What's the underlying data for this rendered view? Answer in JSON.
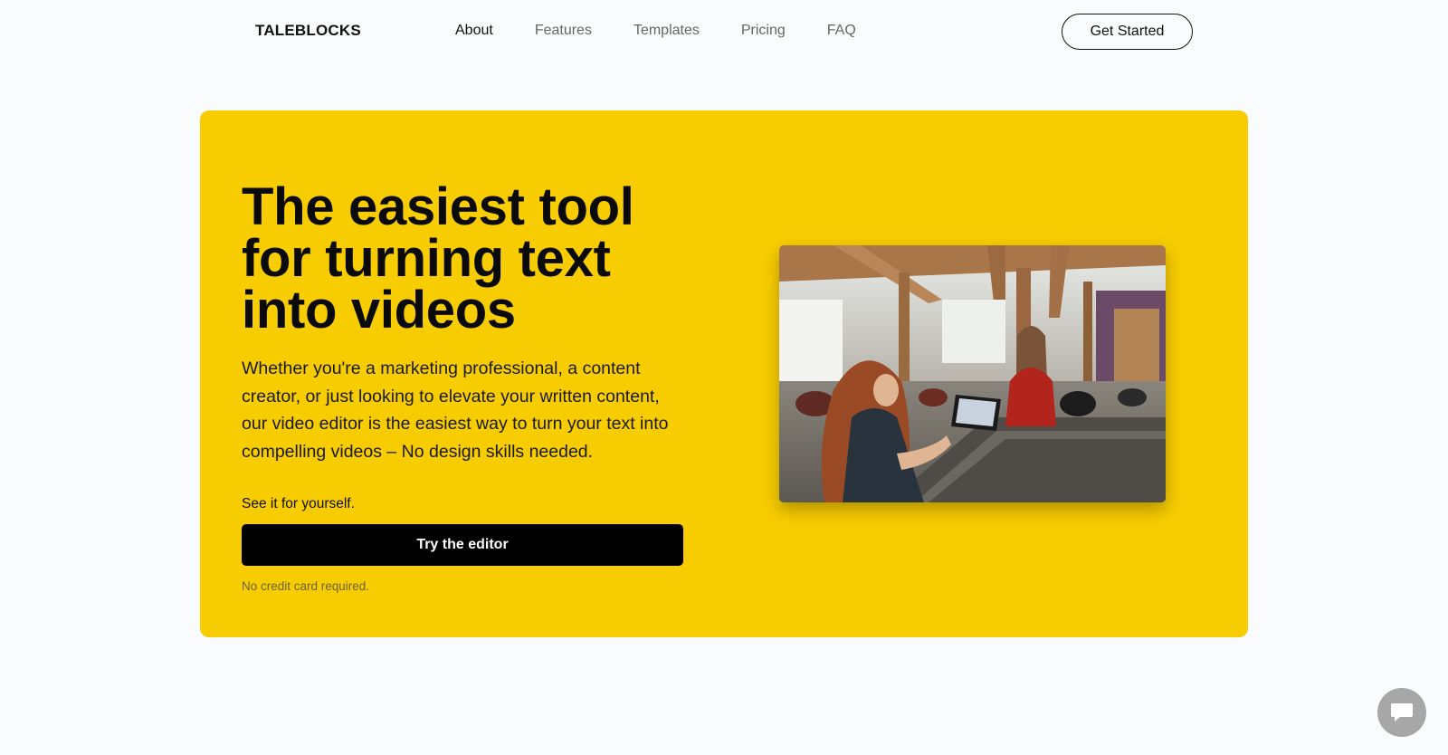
{
  "brand": {
    "name": "TALEBLOCKS"
  },
  "nav": {
    "links": [
      {
        "label": "About",
        "active": true
      },
      {
        "label": "Features",
        "active": false
      },
      {
        "label": "Templates",
        "active": false
      },
      {
        "label": "Pricing",
        "active": false
      },
      {
        "label": "FAQ",
        "active": false
      }
    ],
    "cta_label": "Get Started"
  },
  "hero": {
    "title": "The easiest tool for turning text into videos",
    "description": "Whether you're a marketing professional, a content creator, or just looking to elevate your written content, our video editor is the easiest way to turn your text into compelling videos – No design skills needed.",
    "see_it": "See it for yourself.",
    "button_label": "Try the editor",
    "note": "No credit card required.",
    "image_icon": "photo-salon-reception",
    "background_color": "#f7cc00"
  },
  "chat": {
    "icon": "chat-bubble-icon"
  },
  "colors": {
    "page_bg": "#fafbfc",
    "accent": "#f7cc00",
    "button_bg": "#000000"
  }
}
